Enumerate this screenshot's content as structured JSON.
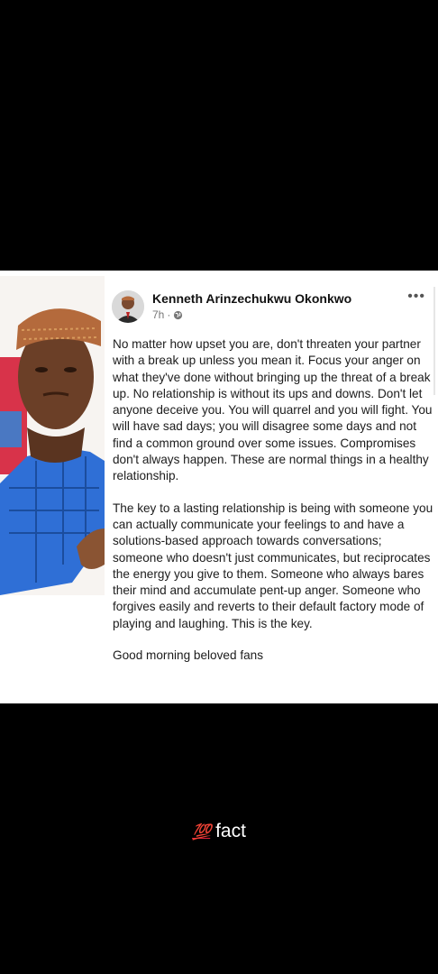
{
  "post": {
    "author_name": "Kenneth Arinzechukwu Okonkwo",
    "time": "7h",
    "more_label": "•••",
    "paragraph1": "No matter how upset you are, don't threaten your partner with a break up unless you mean it. Focus your anger on what they've done without bringing up the threat of a break up. No relationship is without its ups and downs. Don't let anyone deceive you. You will quarrel and you will fight. You will have sad days; you will disagree some days and not find a common ground over some issues. Compromises don't always happen. These are normal things in a healthy relationship.",
    "paragraph2": "The key to a lasting relationship is being with someone you can actually communicate your feelings to and have a solutions-based approach towards conversations; someone who doesn't just communicates, but reciprocates the energy you give to them. Someone who always bares their mind and accumulate pent-up anger. Someone who forgives easily and reverts to their default factory mode of playing and laughing. This is the key.",
    "paragraph3": "Good morning beloved fans"
  },
  "caption": {
    "emoji": "💯",
    "text": "fact"
  },
  "icons": {
    "globe": "globe-icon",
    "more": "more-options-icon"
  }
}
